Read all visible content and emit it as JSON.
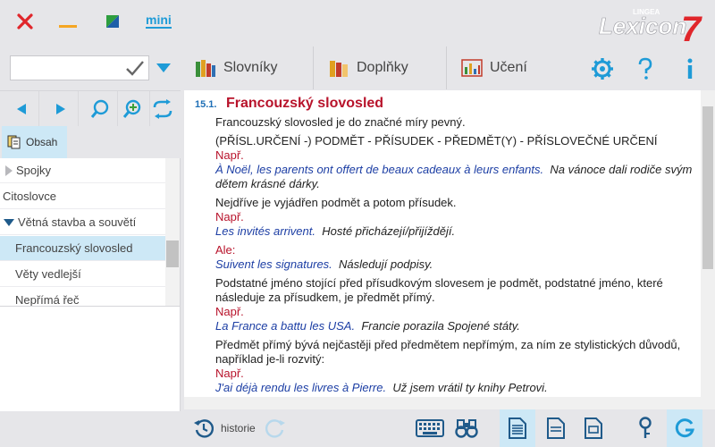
{
  "window": {
    "mini_label": "mini",
    "logo_top": "LINGEA",
    "logo_main": "Lexicon",
    "logo_num": "7"
  },
  "search": {
    "value": "",
    "placeholder": ""
  },
  "toolbar": {
    "tabs": [
      {
        "label": "Slovníky"
      },
      {
        "label": "Doplňky"
      },
      {
        "label": "Učení"
      }
    ]
  },
  "sidebar": {
    "obsah_label": "Obsah",
    "items": [
      {
        "label": "Spojky"
      },
      {
        "label": "Citoslovce"
      },
      {
        "label": "Větná stavba a souvětí"
      },
      {
        "label": "Francouzský slovosled"
      },
      {
        "label": "Věty vedlejší"
      },
      {
        "label": "Nepřímá řeč"
      }
    ]
  },
  "content": {
    "section_number": "15.1.",
    "section_title": "Francouzský slovosled",
    "lines": {
      "l1": "Francouzský slovosled je do značné míry pevný.",
      "l2": "(PŘÍSL.URČENÍ -) PODMĚT - PŘÍSUDEK - PŘEDMĚT(Y) - PŘÍSLOVEČNÉ URČENÍ",
      "napr1": "Např.",
      "fr1": "À Noël, les parents ont offert de beaux cadeaux à leurs enfants.",
      "cz1": "Na vánoce dali rodiče svým dětem krásné dárky.",
      "l3": "Nejdříve je vyjádřen podmět a potom přísudek.",
      "napr2": "Např.",
      "fr2": "Les invités arrivent.",
      "cz2": "Hosté přicházejí/přijíždějí.",
      "ale": "Ale:",
      "fr3": "Suivent les signatures.",
      "cz3": "Následují podpisy.",
      "l4": "Podstatné jméno stojící před přísudkovým slovesem je podmět, podstatné jméno, které následuje za přísudkem, je předmět přímý.",
      "napr3": "Např.",
      "fr4": "La France a battu les USA.",
      "cz4": "Francie porazila Spojené státy.",
      "l5": "Předmět přímý bývá nejčastěji před předmětem nepřímým, za ním ze stylistických důvodů, například je-li rozvitý:",
      "napr4": "Např.",
      "fr5": "J'ai déjà rendu les livres à Pierre.",
      "cz5": "Už jsem vrátil ty knihy Petrovi."
    }
  },
  "bottom": {
    "history_label": "historie"
  },
  "colors": {
    "accent": "#1e9bd7",
    "title_red": "#b8132b",
    "french_blue": "#1c3ea4",
    "selection": "#cde8f6"
  }
}
